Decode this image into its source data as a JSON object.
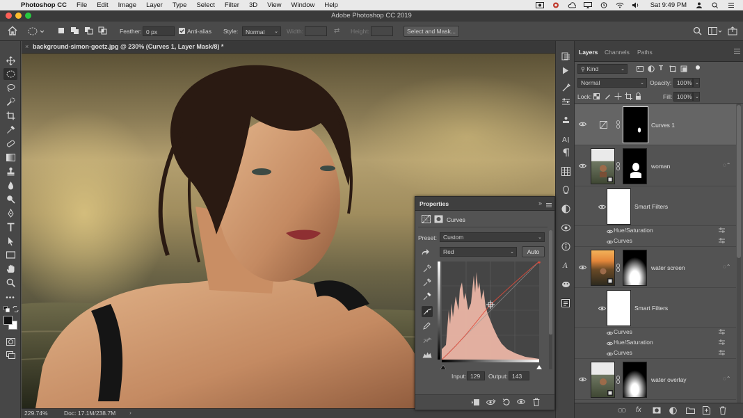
{
  "menubar": {
    "app_name": "Photoshop CC",
    "items": [
      "File",
      "Edit",
      "Image",
      "Layer",
      "Type",
      "Select",
      "Filter",
      "3D",
      "View",
      "Window",
      "Help"
    ],
    "clock": "Sat 9:49 PM"
  },
  "window": {
    "title": "Adobe Photoshop CC 2019"
  },
  "options": {
    "feather_label": "Feather:",
    "feather_value": "0 px",
    "antialias_label": "Anti-alias",
    "antialias_checked": true,
    "style_label": "Style:",
    "style_value": "Normal",
    "width_label": "Width:",
    "height_label": "Height:",
    "select_mask_label": "Select and Mask..."
  },
  "document": {
    "tab_title": "background-simon-goetz.jpg @ 230% (Curves 1, Layer Mask/8) *",
    "zoom": "229.74%",
    "doc_size": "Doc: 17.1M/238.7M"
  },
  "properties": {
    "tab": "Properties",
    "adjustment": "Curves",
    "preset_label": "Preset:",
    "preset_value": "Custom",
    "channel_value": "Red",
    "auto_label": "Auto",
    "input_label": "Input:",
    "input_value": "129",
    "output_label": "Output:",
    "output_value": "143"
  },
  "layers_panel": {
    "tabs": [
      "Layers",
      "Channels",
      "Paths"
    ],
    "filter_kind": "Kind",
    "blend_mode": "Normal",
    "opacity_label": "Opacity:",
    "opacity_value": "100%",
    "lock_label": "Lock:",
    "fill_label": "Fill:",
    "fill_value": "100%",
    "layers": [
      {
        "name": "Curves 1"
      },
      {
        "name": "woman",
        "smart_filters": "Smart Filters",
        "filters": [
          "Hue/Saturation",
          "Curves"
        ]
      },
      {
        "name": "water screen",
        "smart_filters": "Smart Filters",
        "filters": [
          "Curves",
          "Hue/Saturation",
          "Curves"
        ]
      },
      {
        "name": "water overlay"
      }
    ]
  },
  "colors": {
    "accent_curve": "#e04a3a",
    "histogram_fill": "#f0b8a8",
    "selected_layer": "#656565"
  }
}
